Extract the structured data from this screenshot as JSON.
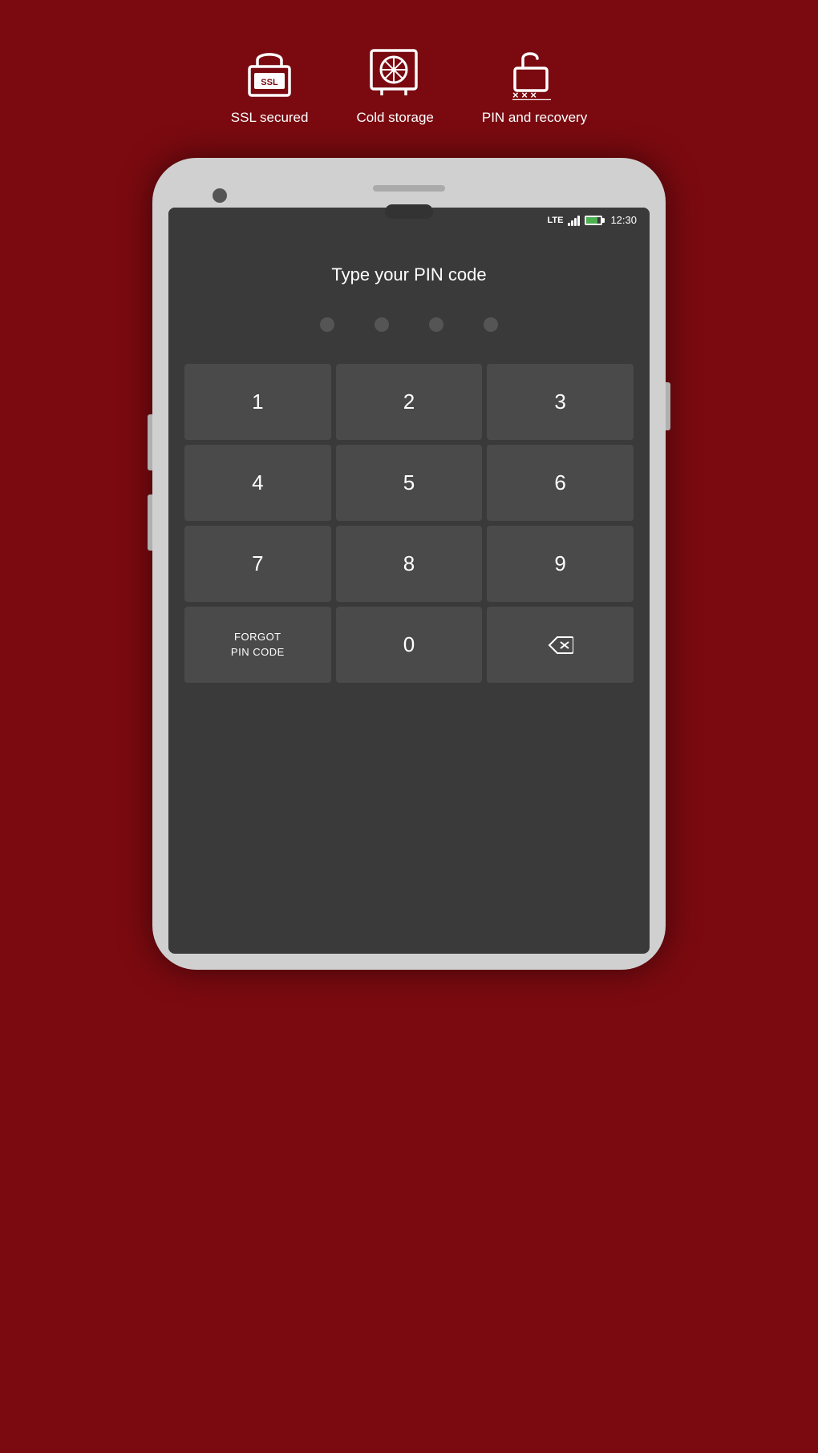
{
  "background_color": "#7a0a10",
  "top_icons": [
    {
      "id": "ssl",
      "label": "SSL secured",
      "icon": "ssl-lock-icon"
    },
    {
      "id": "cold_storage",
      "label": "Cold storage",
      "icon": "vault-icon"
    },
    {
      "id": "pin_recovery",
      "label": "PIN and recovery",
      "icon": "pin-lock-icon"
    }
  ],
  "status_bar": {
    "lte": "LTE",
    "time": "12:30"
  },
  "pin_screen": {
    "title": "Type your PIN code",
    "dots_count": 4,
    "keypad": [
      [
        "1",
        "2",
        "3"
      ],
      [
        "4",
        "5",
        "6"
      ],
      [
        "7",
        "8",
        "9"
      ],
      [
        "FORGOT\nPIN CODE",
        "0",
        "⌫"
      ]
    ]
  }
}
